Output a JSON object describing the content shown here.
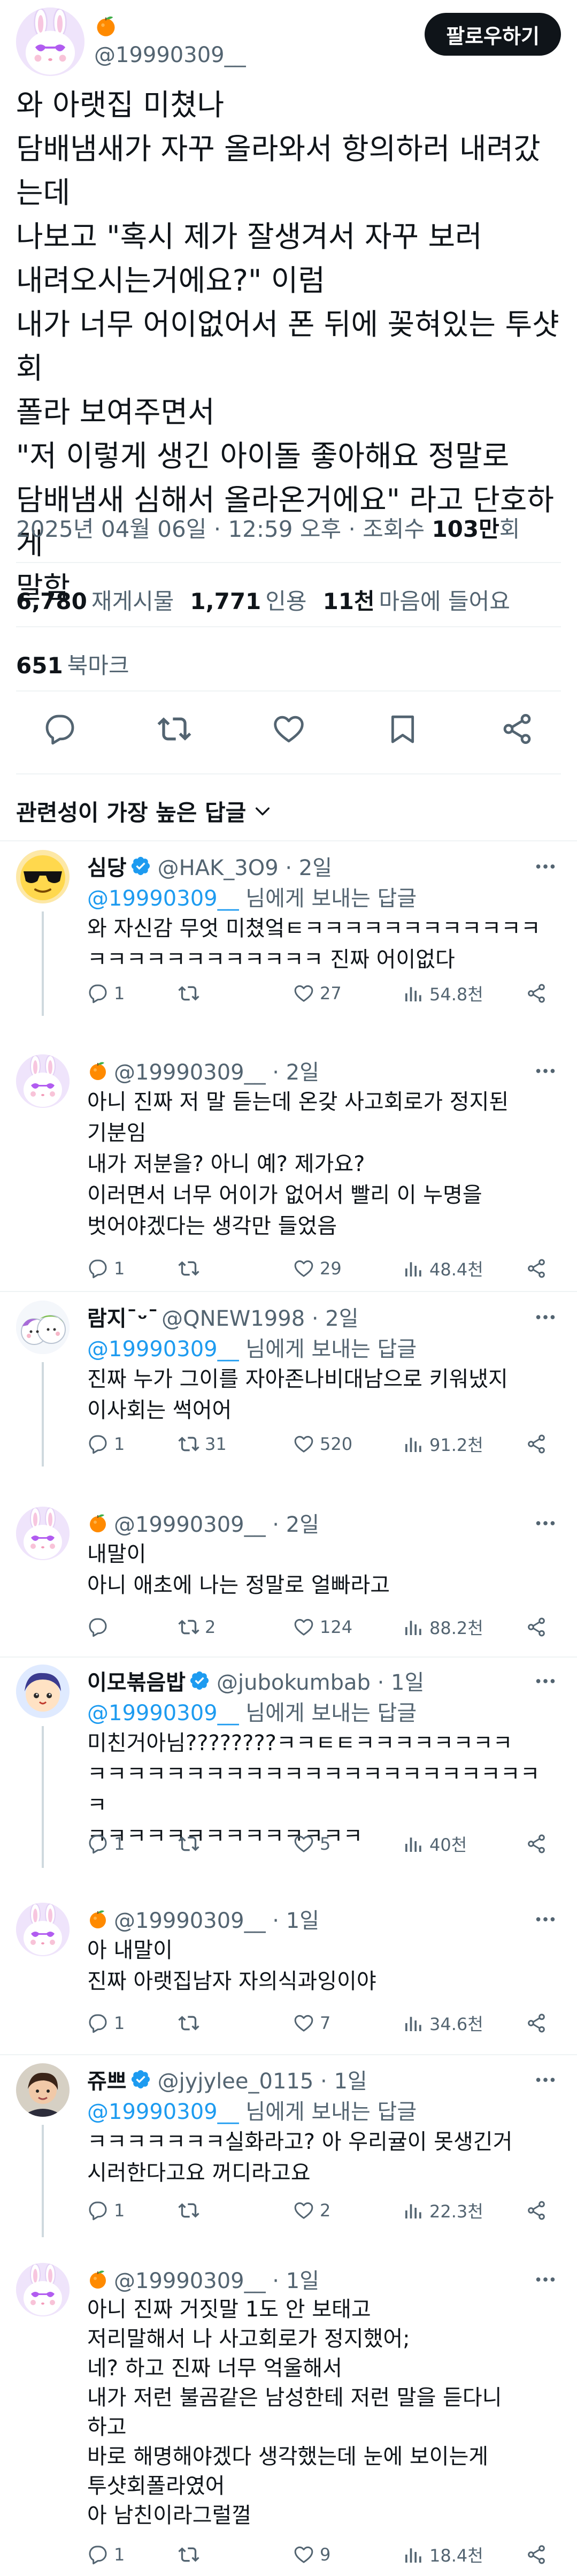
{
  "post": {
    "handle": "@19990309__",
    "follow_label": "팔로우하기",
    "text": "와 아랫집 미쳤나\n담배냄새가 자꾸 올라와서 항의하러 내려갔는데\n나보고 \"혹시 제가 잘생겨서 자꾸 보러\n내려오시는거에요?\" 이럼\n내가 너무 어이없어서 폰 뒤에 꽂혀있는 투샷회\n폴라 보여주면서\n\"저 이렇게 생긴 아이돌 좋아해요 정말로\n담배냄새 심해서 올라온거에요\" 라고 단호하게\n말함",
    "date": "2025년 04월 06일 · 12:59 오후 · 조회수 ",
    "views": "103만",
    "views_suffix": "회",
    "reposts_count": "6,780",
    "reposts_label": "재게시물",
    "quotes_count": "1,771",
    "quotes_label": "인용",
    "likes_count": "11천",
    "likes_label": "마음에 들어요",
    "bookmarks_count": "651",
    "bookmarks_label": "북마크"
  },
  "sort_label": "관련성이 가장 높은 답글",
  "replies": [
    {
      "name": "심당",
      "verified": true,
      "handle": "@HAK_3O9 · 2일",
      "reply_to": "@19990309__",
      "reply_to_suffix": " 님에게 보내는 답글",
      "text": "와 자신감 무엇 미쳤엌ㅌㅋㅋㅋㅋㅋㅋㅋㅋㅋㅋㅋㅋ\nㅋㅋㅋㅋㅋㅋㅋㅋㅋㅋㅋㅋ 진짜 어이없다",
      "replies": "1",
      "reposts": "",
      "likes": "27",
      "views": "54.8천"
    },
    {
      "name": "",
      "verified": false,
      "handle": "@19990309__ · 2일",
      "text": "아니 진짜 저 말 듣는데 온갖 사고회로가 정지된\n기분임\n내가 저분을? 아니 예? 제가요?\n이러면서 너무 어이가 없어서 빨리 이 누명을\n벗어야겠다는 생각만 들었음",
      "replies": "1",
      "reposts": "",
      "likes": "29",
      "views": "48.4천"
    },
    {
      "name": "람지¯ᵕ¯",
      "verified": false,
      "handle": "@QNEW1998 · 2일",
      "reply_to": "@19990309__",
      "reply_to_suffix": " 님에게 보내는 답글",
      "text": "진짜 누가 그이를 자아존나비대남으로 키워냈지\n이사회는 썩어어",
      "replies": "1",
      "reposts": "31",
      "likes": "520",
      "views": "91.2천"
    },
    {
      "name": "",
      "verified": false,
      "handle": "@19990309__ · 2일",
      "text": "내말이\n아니 애초에 나는 정말로 얼빠라고",
      "replies": "",
      "reposts": "2",
      "likes": "124",
      "views": "88.2천"
    },
    {
      "name": "이모볶음밥",
      "verified": true,
      "handle": "@jubokumbab · 1일",
      "reply_to": "@19990309__",
      "reply_to_suffix": " 님에게 보내는 답글",
      "text": "미친거아님????????ㅋㅋㅌㅌㅋㅋㅋㅋㅋㅋㅋㅋ\nㅋㅋㅋㅋㅋㅋㅋㅋㅋㅋㅋㅋㅋㅋㅋㅋㅋㅋㅋㅋㅋㅋㅋㅋ\nㅋㅋㅋㅋㅋㅋㅋㅋㅋㅋㅋㅋㅋㅋ",
      "replies": "1",
      "reposts": "",
      "likes": "5",
      "views": "40천"
    },
    {
      "name": "",
      "verified": false,
      "handle": "@19990309__ · 1일",
      "text": "아 내말이\n진짜 아랫집남자 자의식과잉이야",
      "replies": "1",
      "reposts": "",
      "likes": "7",
      "views": "34.6천"
    },
    {
      "name": "쥬쁘",
      "verified": true,
      "handle": "@jyjylee_0115 · 1일",
      "reply_to": "@19990309__",
      "reply_to_suffix": " 님에게 보내는 답글",
      "text": "ㅋㅋㅋㅋㅋㅋㅋ실화라고? 아 우리귤이 못생긴거\n시러한다고요 꺼디라고요",
      "replies": "1",
      "reposts": "",
      "likes": "2",
      "views": "22.3천"
    },
    {
      "name": "",
      "verified": false,
      "handle": "@19990309__ · 1일",
      "text": "아니 진짜 거짓말 1도 안 보태고\n저리말해서 나 사고회로가 정지했어;\n네? 하고 진짜 너무 억울해서\n내가 저런 불곰같은 남성한테 저런 말을 듣다니\n하고\n바로 해명해야겠다 생각했는데 눈에 보이는게\n투샷회폴라였어\n아 남친이라그럴껄",
      "replies": "1",
      "reposts": "",
      "likes": "9",
      "views": "18.4천"
    }
  ],
  "icons": {
    "fruit": "tangerine-icon",
    "verified": "verified-badge-icon",
    "reply": "reply-icon",
    "repost": "repost-icon",
    "like": "heart-icon",
    "bookmark": "bookmark-icon",
    "share": "share-icon",
    "views": "views-icon",
    "more": "more-icon",
    "sort": "chevron-down-icon"
  },
  "colors": {
    "link": "#1d9bf0",
    "muted": "#536471",
    "verified": "#1d9bf0",
    "text": "#0f1419"
  }
}
